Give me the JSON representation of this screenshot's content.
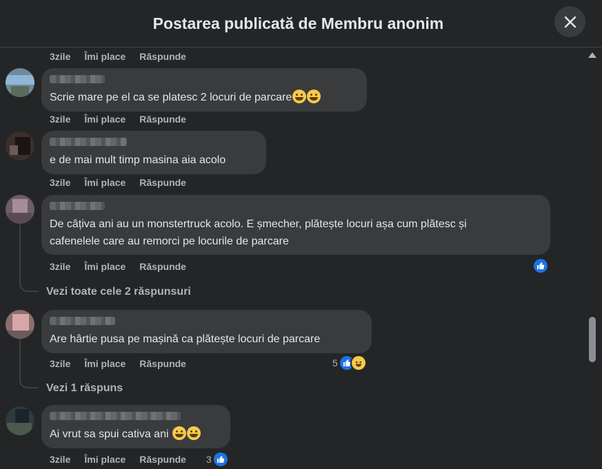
{
  "header": {
    "title": "Postarea publicată de Membru anonim"
  },
  "top_actions": {
    "time": "3zile",
    "like": "Îmi place",
    "reply": "Răspunde"
  },
  "comments": [
    {
      "text": "Scrie mare pe el ca se platesc 2 locuri de parcare",
      "emoji": [
        "sweat-smile-emoji",
        "sweat-smile-emoji"
      ],
      "time": "3zile",
      "like": "Îmi place",
      "reply": "Răspunde"
    },
    {
      "text": "e de mai mult timp masina aia acolo",
      "time": "3zile",
      "like": "Îmi place",
      "reply": "Răspunde"
    },
    {
      "text_line1": "De câțiva ani au un monstertruck acolo. E șmecher, plătește locuri așa cum plătesc și",
      "text_line2": "cafenelele care au remorci pe locurile de parcare",
      "time": "3zile",
      "like": "Îmi place",
      "reply": "Răspunde",
      "see_replies": "Vezi toate cele 2 răspunsuri"
    },
    {
      "text": "Are hârtie pusa pe mașină ca plătește locuri de parcare",
      "time": "3zile",
      "like": "Îmi place",
      "reply": "Răspunde",
      "reaction_count": "5",
      "see_replies": "Vezi 1 răspuns"
    },
    {
      "text": "Ai vrut sa spui cativa ani ",
      "emoji": [
        "tears-of-joy-emoji",
        "tears-of-joy-emoji"
      ],
      "time": "3zile",
      "like": "Îmi place",
      "reply": "Răspunde",
      "reaction_count": "3"
    }
  ],
  "colors": {
    "background": "#242526",
    "bubble": "#3a3b3c",
    "accent": "#1b74e4",
    "muted_text": "#b0b3b8"
  }
}
